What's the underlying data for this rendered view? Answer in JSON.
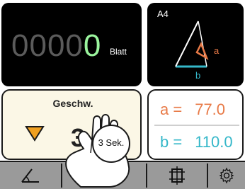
{
  "counter": {
    "zeros": "0000",
    "active_digit": "0",
    "unit": "Blatt"
  },
  "format": {
    "label": "A4",
    "side_a": "a",
    "side_b": "b"
  },
  "speed": {
    "title": "Geschw.",
    "value": "3"
  },
  "dimensions": {
    "a_label": "a =",
    "a_value": "77.0",
    "b_label": "b =",
    "b_value": "110.0"
  },
  "hint": {
    "text": "3 Sek."
  },
  "tabs": [
    {
      "icon": "triangle-angle-icon"
    },
    {
      "icon": "paper-feed-icon",
      "active": true
    },
    {
      "icon": "sheet-cut-icon"
    },
    {
      "icon": "gear-icon"
    }
  ],
  "colors": {
    "side_a": "#e87a47",
    "side_b": "#34b7c9",
    "active_digit": "#9bf59e",
    "decrease": "#f0a020",
    "tab_active": "#34b7c9"
  }
}
